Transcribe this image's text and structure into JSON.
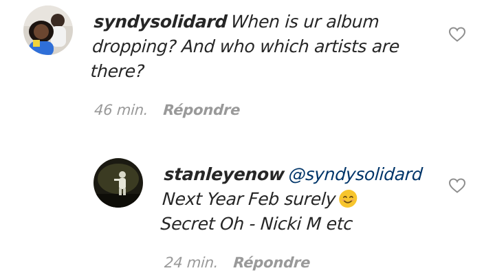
{
  "comments": [
    {
      "username": "syndysolidard",
      "text_line1": "When is ur album",
      "text_line2": "dropping? And who which artists are",
      "text_line3": "there?",
      "time": "46 min.",
      "reply_label": "Répondre",
      "avatar_icon": "user-avatar-photo",
      "like_icon": "heart-outline-icon"
    },
    {
      "username": "stanleyenow",
      "mention": "@syndysolidard",
      "text_line1": "Next Year Feb surely",
      "text_line2": "Secret Oh - Nicki M etc",
      "emoji": "smiling-face-emoji",
      "time": "24 min.",
      "reply_label": "Répondre",
      "avatar_icon": "user-avatar-photo",
      "like_icon": "heart-outline-icon"
    }
  ],
  "colors": {
    "text": "#262626",
    "meta": "#999999",
    "mention": "#003569",
    "heart": "#8e8e8e"
  }
}
